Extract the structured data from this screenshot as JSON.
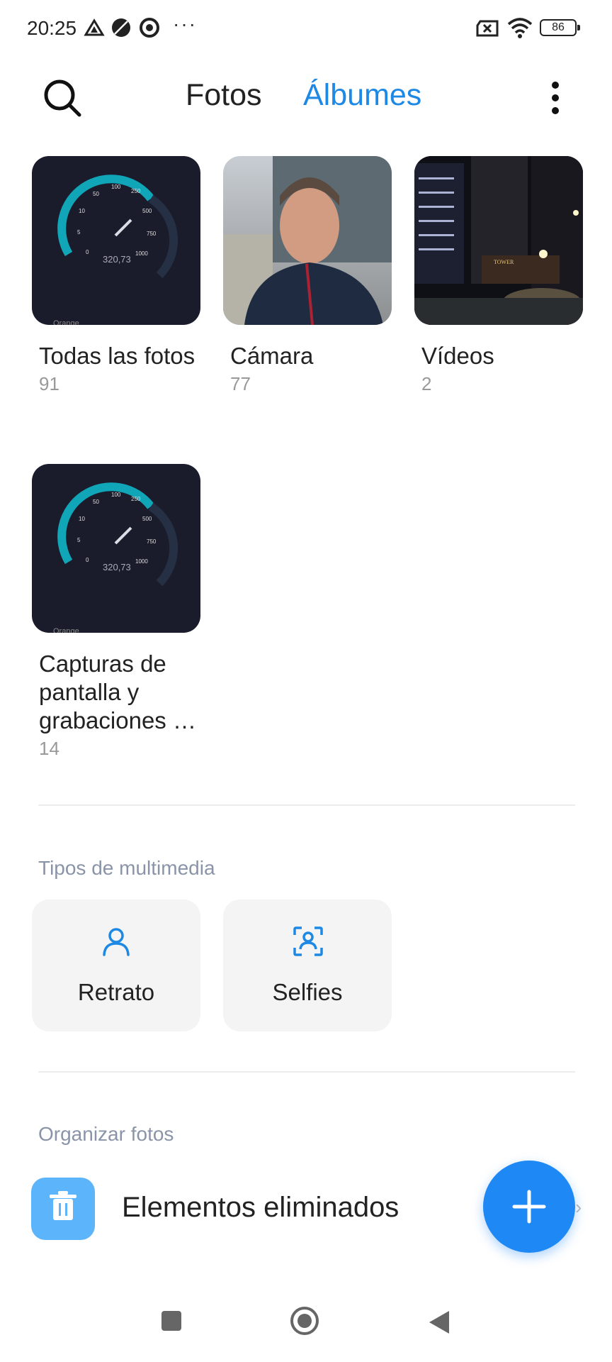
{
  "status_bar": {
    "time": "20:25",
    "icons": [
      "drive-icon",
      "dark-circle-icon",
      "chrome-icon"
    ],
    "more": "···",
    "battery": "86"
  },
  "top_bar": {
    "search_icon": "search-icon",
    "tabs": [
      {
        "label": "Fotos",
        "active": false
      },
      {
        "label": "Álbumes",
        "active": true
      }
    ],
    "menu_icon": "more-vertical-icon",
    "accent_color": "#1e88e5"
  },
  "albums": [
    {
      "name": "Todas las fotos",
      "count": "91",
      "thumb": "speedtest-screenshot",
      "thumb_text": "320,73",
      "thumb_brand": "Orange"
    },
    {
      "name": "Cámara",
      "count": "77",
      "thumb": "selfie-photo"
    },
    {
      "name": "Vídeos",
      "count": "2",
      "thumb": "night-building-photo",
      "thumb_text": "TOWER"
    },
    {
      "name": "Capturas de pantalla y grabaciones …",
      "count": "14",
      "thumb": "speedtest-screenshot",
      "thumb_text": "320,73",
      "thumb_brand": "Orange"
    }
  ],
  "speed_ticks": [
    "0",
    "5",
    "10",
    "50",
    "100",
    "250",
    "500",
    "750",
    "1000"
  ],
  "media_types": {
    "title": "Tipos de multimedia",
    "items": [
      {
        "label": "Retrato",
        "icon": "portrait-icon"
      },
      {
        "label": "Selfies",
        "icon": "selfie-icon"
      }
    ]
  },
  "organize": {
    "title": "Organizar fotos",
    "items": [
      {
        "label": "Elementos eliminados",
        "icon": "trash-icon"
      }
    ]
  },
  "fab": {
    "icon": "plus-icon"
  },
  "nav_bar": [
    "recents-icon",
    "home-icon",
    "back-icon"
  ]
}
